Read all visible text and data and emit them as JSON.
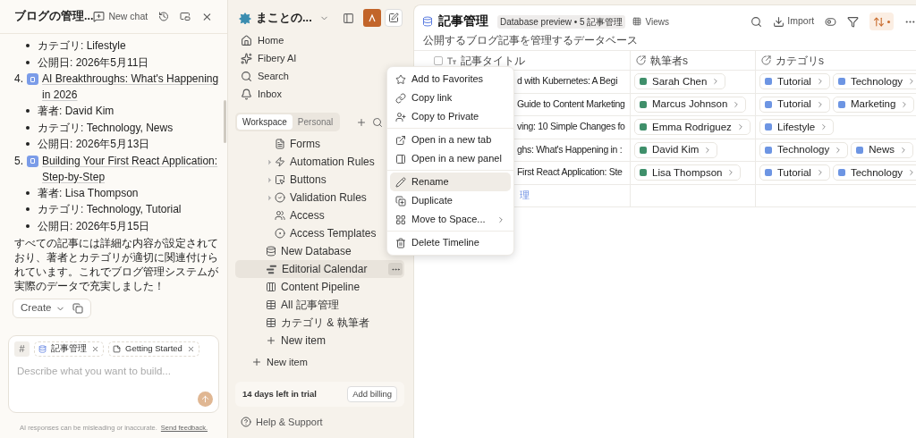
{
  "chat": {
    "title": "ブログの管理...",
    "new_chat": "New chat",
    "messages": [
      {
        "kind": "bullet",
        "text": "カテゴリ: Lifestyle"
      },
      {
        "kind": "bullet",
        "text": "公開日: 2026年5月11日"
      },
      {
        "kind": "item",
        "number": "4.",
        "text": "AI Breakthroughs: What's Happening in 2026"
      },
      {
        "kind": "bullet",
        "text": "著者: David Kim"
      },
      {
        "kind": "bullet",
        "text": "カテゴリ: Technology, News"
      },
      {
        "kind": "bullet",
        "text": "公開日: 2026年5月13日"
      },
      {
        "kind": "item",
        "number": "5.",
        "text": "Building Your First React Application: Step-by-Step"
      },
      {
        "kind": "bullet",
        "text": "著者: Lisa Thompson"
      },
      {
        "kind": "bullet",
        "text": "カテゴリ: Technology, Tutorial"
      },
      {
        "kind": "bullet",
        "text": "公開日: 2026年5月15日"
      },
      {
        "kind": "paragraph",
        "text": "すべての記事には詳細な内容が設定されており、著者とカテゴリが適切に関連付けられています。これでブログ管理システムが実際のデータで充実しました！"
      }
    ],
    "create": "Create",
    "hash": "#",
    "context": [
      {
        "kind": "database",
        "label": "記事管理"
      },
      {
        "kind": "doc",
        "label": "Getting Started"
      }
    ],
    "placeholder": "Describe what you want to build...",
    "disclaimer": "AI responses can be misleading or inaccurate.",
    "feedback": "Send feedback."
  },
  "sidebar": {
    "workspace": "まことの...",
    "nav": [
      {
        "kind": "home",
        "label": "Home"
      },
      {
        "kind": "ai",
        "label": "Fibery AI"
      },
      {
        "kind": "search",
        "label": "Search"
      },
      {
        "kind": "inbox",
        "label": "Inbox"
      }
    ],
    "tabs": [
      {
        "label": "Workspace",
        "selected": true
      },
      {
        "label": "Personal",
        "selected": false
      }
    ],
    "tree": [
      {
        "kind": "group",
        "children": [
          {
            "kind": "form",
            "label": "Forms",
            "selected": false
          },
          {
            "kind": "automation",
            "label": "Automation Rules",
            "expanded": false,
            "selected": false
          },
          {
            "kind": "button",
            "label": "Buttons",
            "expanded": false,
            "selected": false
          },
          {
            "kind": "validation",
            "label": "Validation Rules",
            "expanded": false,
            "selected": false
          },
          {
            "kind": "access",
            "label": "Access",
            "selected": false
          },
          {
            "kind": "template",
            "label": "Access Templates",
            "selected": false
          }
        ]
      },
      {
        "kind": "database",
        "label": "New Database",
        "selected": false
      },
      {
        "kind": "timeline",
        "label": "Editorial Calendar",
        "selected": true
      },
      {
        "kind": "board",
        "label": "Content Pipeline",
        "selected": false
      },
      {
        "kind": "table",
        "label": "All 記事管理",
        "selected": false
      },
      {
        "kind": "table",
        "label": "カテゴリ & 執筆者",
        "selected": false
      },
      {
        "kind": "add",
        "label": "New item",
        "selected": false
      }
    ],
    "new_item": "New item",
    "trial": "14 days left in trial",
    "billing": "Add billing",
    "help": "Help & Support"
  },
  "database": {
    "title": "記事管理",
    "badge": "Database preview • 5 記事管理",
    "views": "Views",
    "toolbar": [
      {
        "kind": "search",
        "active": false
      },
      {
        "kind": "import",
        "label": "Import",
        "active": false
      },
      {
        "kind": "toggle",
        "active": false
      },
      {
        "kind": "filter",
        "active": false
      },
      {
        "kind": "sort",
        "active": true
      },
      {
        "kind": "more",
        "active": false
      }
    ],
    "description": "公開するブログ記事を管理するデータベース",
    "select_all": {
      "checked": false
    },
    "columns": [
      {
        "kind": "text",
        "label": "記事タイトル"
      },
      {
        "kind": "relation",
        "label": "執筆者s"
      },
      {
        "kind": "relation",
        "label": "カテゴリs"
      }
    ],
    "rows": [
      {
        "title": "d with Kubernetes: A Begi",
        "authors": [
          "Sarah Chen"
        ],
        "categories": [
          "Tutorial",
          "Technology"
        ]
      },
      {
        "title": "Guide to Content Marketing",
        "authors": [
          "Marcus Johnson"
        ],
        "categories": [
          "Tutorial",
          "Marketing"
        ]
      },
      {
        "title": "ving: 10 Simple Changes fo",
        "authors": [
          "Emma Rodriguez"
        ],
        "categories": [
          "Lifestyle"
        ]
      },
      {
        "title": "ghs: What's Happening in :",
        "authors": [
          "David Kim"
        ],
        "categories": [
          "Technology",
          "News"
        ]
      },
      {
        "title": "First React Application: Ste",
        "authors": [
          "Lisa Thompson"
        ],
        "categories": [
          "Tutorial",
          "Technology"
        ]
      }
    ],
    "new_row": "理"
  },
  "context_menu": {
    "items": [
      {
        "kind": "star",
        "label": "Add to Favorites",
        "divider_above": false,
        "selected": false
      },
      {
        "kind": "link",
        "label": "Copy link",
        "divider_above": false,
        "selected": false
      },
      {
        "kind": "private",
        "label": "Copy to Private",
        "divider_above": false,
        "selected": false
      },
      {
        "kind": "tab",
        "label": "Open in a new tab",
        "divider_above": true,
        "selected": false
      },
      {
        "kind": "panel",
        "label": "Open in a new panel",
        "divider_above": false,
        "selected": false
      },
      {
        "kind": "rename",
        "label": "Rename",
        "divider_above": true,
        "selected": true
      },
      {
        "kind": "duplicate",
        "label": "Duplicate",
        "divider_above": false,
        "selected": false
      },
      {
        "kind": "move",
        "label": "Move to Space...",
        "divider_above": false,
        "submenu": true,
        "selected": false
      },
      {
        "kind": "delete",
        "label": "Delete Timeline",
        "divider_above": true,
        "selected": false
      }
    ]
  }
}
